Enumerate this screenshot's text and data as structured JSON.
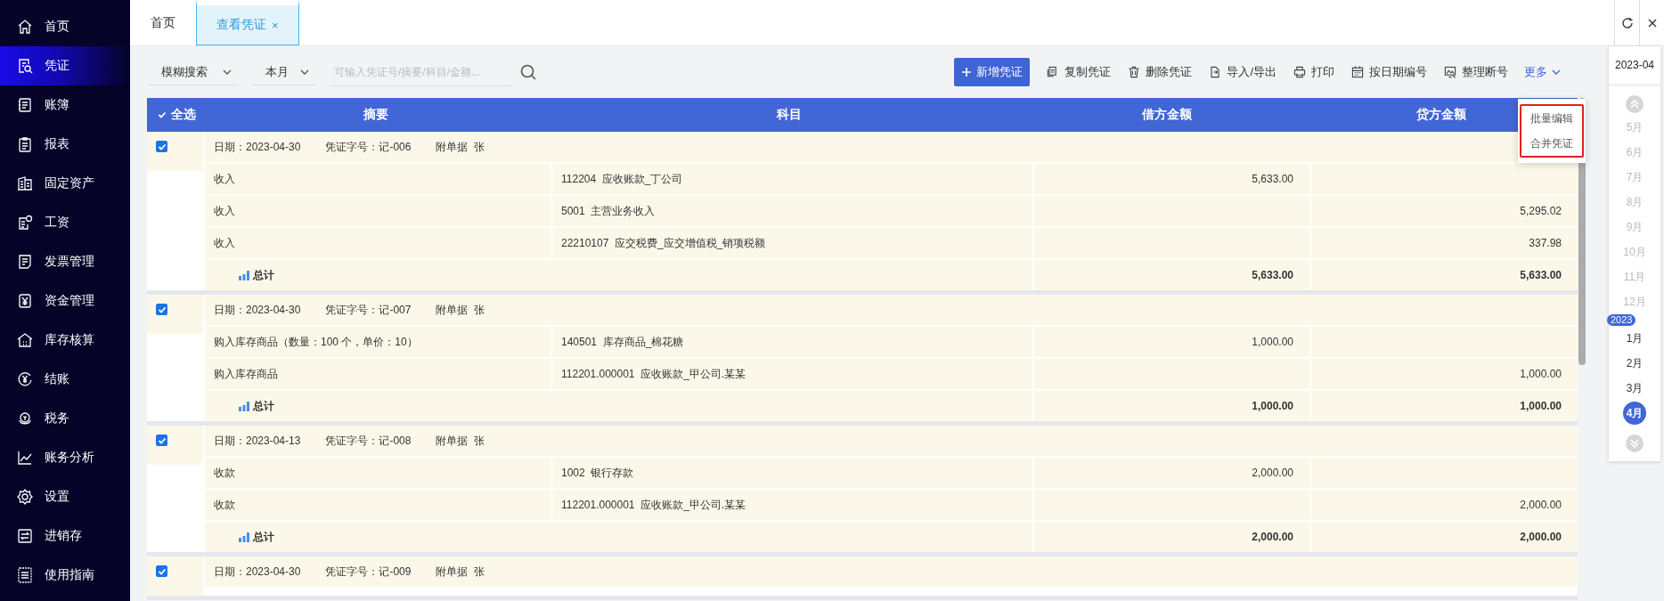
{
  "sidebar": {
    "items": [
      {
        "label": "首页",
        "selected": false
      },
      {
        "label": "凭证",
        "selected": true
      },
      {
        "label": "账簿",
        "selected": false
      },
      {
        "label": "报表",
        "selected": false
      },
      {
        "label": "固定资产",
        "selected": false
      },
      {
        "label": "工资",
        "selected": false
      },
      {
        "label": "发票管理",
        "selected": false
      },
      {
        "label": "资金管理",
        "selected": false
      },
      {
        "label": "库存核算",
        "selected": false
      },
      {
        "label": "结账",
        "selected": false
      },
      {
        "label": "税务",
        "selected": false
      },
      {
        "label": "账务分析",
        "selected": false
      },
      {
        "label": "设置",
        "selected": false
      },
      {
        "label": "进销存",
        "selected": false
      },
      {
        "label": "使用指南",
        "selected": false
      }
    ]
  },
  "tabs": [
    {
      "label": "首页",
      "selected": false
    },
    {
      "label": "查看凭证",
      "selected": true,
      "close": "×"
    }
  ],
  "filters": {
    "search_mode": "模糊搜索",
    "period": "本月",
    "search": {
      "placeholder": "可输入凭证号/摘要/科目/金额..."
    }
  },
  "toolbar": {
    "primary": "新增凭证",
    "buttons": [
      {
        "label": "复制凭证"
      },
      {
        "label": "删除凭证"
      },
      {
        "label": "导入/导出"
      },
      {
        "label": "打印"
      },
      {
        "label": "按日期编号"
      },
      {
        "label": "整理断号"
      }
    ],
    "more": "更多",
    "more_menu": [
      {
        "label": "批量编辑"
      },
      {
        "label": "合并凭证"
      }
    ]
  },
  "table": {
    "select_all": {
      "label": "全选",
      "checked": true
    },
    "columns": [
      "摘要",
      "科目",
      "借方金额",
      "贷方金额"
    ],
    "vouchers": [
      {
        "checked": true,
        "date": "日期：2023-04-30",
        "number": "凭证字号：记-006",
        "attachments": "附单据  张",
        "lines": [
          {
            "summary": "收入",
            "account": "112204  应收账款_丁公司",
            "debit": "5,633.00"
          },
          {
            "summary": "收入",
            "account": "5001  主营业务收入",
            "credit": "5,295.02"
          },
          {
            "summary": "收入",
            "account": "22210107  应交税费_应交增值税_销项税额",
            "credit": "337.98"
          }
        ],
        "total": {
          "label": "总计",
          "debit": "5,633.00",
          "credit": "5,633.00"
        }
      },
      {
        "checked": true,
        "date": "日期：2023-04-30",
        "number": "凭证字号：记-007",
        "attachments": "附单据  张",
        "lines": [
          {
            "summary": "购入库存商品（数量：100 个，单价：10）",
            "account": "140501  库存商品_棉花糖",
            "debit": "1,000.00"
          },
          {
            "summary": "购入库存商品",
            "account": "112201.000001  应收账款_甲公司.某某",
            "credit": "1,000.00"
          }
        ],
        "total": {
          "label": "总计",
          "debit": "1,000.00",
          "credit": "1,000.00"
        }
      },
      {
        "checked": true,
        "date": "日期：2023-04-13",
        "number": "凭证字号：记-008",
        "attachments": "附单据  张",
        "lines": [
          {
            "summary": "收款",
            "account": "1002  银行存款",
            "debit": "2,000.00"
          },
          {
            "summary": "收款",
            "account": "112201.000001  应收账款_甲公司.某某",
            "credit": "2,000.00"
          }
        ],
        "total": {
          "label": "总计",
          "debit": "2,000.00",
          "credit": "2,000.00"
        }
      },
      {
        "checked": true,
        "date": "日期：2023-04-30",
        "number": "凭证字号：记-009",
        "attachments": "附单据  张"
      }
    ]
  },
  "calendar": {
    "current": "2023-04",
    "year_badge": "2023",
    "months": [
      {
        "label": "5月",
        "disabled": true,
        "selected": false
      },
      {
        "label": "6月",
        "disabled": true,
        "selected": false
      },
      {
        "label": "7月",
        "disabled": true,
        "selected": false
      },
      {
        "label": "8月",
        "disabled": true,
        "selected": false
      },
      {
        "label": "9月",
        "disabled": true,
        "selected": false
      },
      {
        "label": "10月",
        "disabled": true,
        "selected": false
      },
      {
        "label": "11月",
        "disabled": true,
        "selected": false
      },
      {
        "label": "12月",
        "disabled": true,
        "selected": false
      },
      {
        "label": "1月",
        "disabled": false,
        "selected": false
      },
      {
        "label": "2月",
        "disabled": false,
        "selected": false
      },
      {
        "label": "3月",
        "disabled": false,
        "selected": false
      },
      {
        "label": "4月",
        "disabled": false,
        "selected": true
      }
    ]
  }
}
